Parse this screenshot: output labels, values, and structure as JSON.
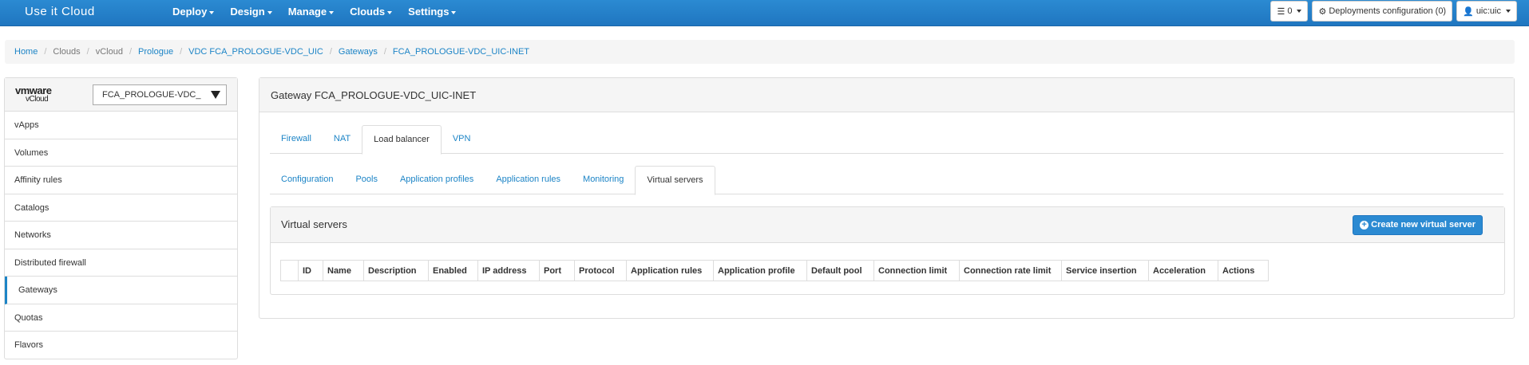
{
  "app": {
    "title": "Use it Cloud"
  },
  "nav": {
    "menus": [
      "Deploy",
      "Design",
      "Manage",
      "Clouds",
      "Settings"
    ],
    "right": {
      "list_count": "0",
      "deployments_config": "Deployments configuration (0)",
      "user": "uic:uic"
    }
  },
  "breadcrumb": [
    {
      "label": "Home",
      "link": true
    },
    {
      "label": "Clouds",
      "link": false
    },
    {
      "label": "vCloud",
      "link": false
    },
    {
      "label": "Prologue",
      "link": true
    },
    {
      "label": "VDC FCA_PROLOGUE-VDC_UIC",
      "link": true
    },
    {
      "label": "Gateways",
      "link": true
    },
    {
      "label": "FCA_PROLOGUE-VDC_UIC-INET",
      "link": true
    }
  ],
  "sidebar": {
    "logo": "vmware",
    "logo_sub": "vCloud",
    "select_value": "FCA_PROLOGUE-VDC_",
    "items": [
      {
        "label": "vApps",
        "active": false
      },
      {
        "label": "Volumes",
        "active": false
      },
      {
        "label": "Affinity rules",
        "active": false
      },
      {
        "label": "Catalogs",
        "active": false
      },
      {
        "label": "Networks",
        "active": false
      },
      {
        "label": "Distributed firewall",
        "active": false
      },
      {
        "label": "Gateways",
        "active": true
      },
      {
        "label": "Quotas",
        "active": false
      },
      {
        "label": "Flavors",
        "active": false
      }
    ]
  },
  "main": {
    "title": "Gateway FCA_PROLOGUE-VDC_UIC-INET",
    "tabs": [
      "Firewall",
      "NAT",
      "Load balancer",
      "VPN"
    ],
    "active_tab": 2,
    "subtabs": [
      "Configuration",
      "Pools",
      "Application profiles",
      "Application rules",
      "Monitoring",
      "Virtual servers"
    ],
    "active_subtab": 5,
    "virtual_servers": {
      "title": "Virtual servers",
      "create_label": "Create new virtual server",
      "columns": [
        "",
        "ID",
        "Name",
        "Description",
        "Enabled",
        "IP address",
        "Port",
        "Protocol",
        "Application rules",
        "Application profile",
        "Default pool",
        "Connection limit",
        "Connection rate limit",
        "Service insertion",
        "Acceleration",
        "Actions"
      ]
    }
  },
  "colors": {
    "accent": "#1c84c6",
    "navbar": "#2b8ad2"
  }
}
